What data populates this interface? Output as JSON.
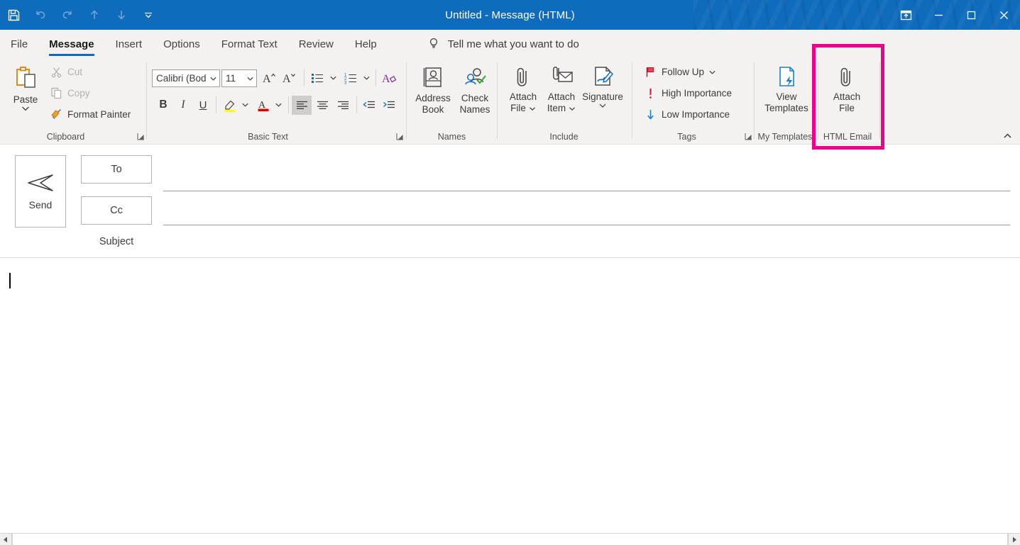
{
  "window": {
    "title": "Untitled  -  Message (HTML)",
    "accent_color": "#0f6cbd",
    "highlight_color": "#ec008c"
  },
  "quick_access": {
    "items": [
      {
        "name": "save-icon",
        "label": "Save",
        "enabled": true
      },
      {
        "name": "undo-icon",
        "label": "Undo",
        "enabled": false
      },
      {
        "name": "redo-icon",
        "label": "Redo",
        "enabled": false
      },
      {
        "name": "previous-item-icon",
        "label": "Previous Item",
        "enabled": false
      },
      {
        "name": "next-item-icon",
        "label": "Next Item",
        "enabled": false
      },
      {
        "name": "customize-quick-access-toolbar-icon",
        "label": "Customize Quick Access Toolbar",
        "enabled": true
      }
    ]
  },
  "window_controls": [
    {
      "name": "ribbon-display-options-icon",
      "label": "Ribbon Display Options"
    },
    {
      "name": "minimize-icon",
      "label": "Minimize"
    },
    {
      "name": "maximize-icon",
      "label": "Maximize"
    },
    {
      "name": "close-icon",
      "label": "Close"
    }
  ],
  "tabs": [
    {
      "label": "File",
      "active": false
    },
    {
      "label": "Message",
      "active": true
    },
    {
      "label": "Insert",
      "active": false
    },
    {
      "label": "Options",
      "active": false
    },
    {
      "label": "Format Text",
      "active": false
    },
    {
      "label": "Review",
      "active": false
    },
    {
      "label": "Help",
      "active": false
    }
  ],
  "tell_me": {
    "label": "Tell me what you want to do",
    "icon": "lightbulb-icon"
  },
  "ribbon": {
    "collapse_label": "Collapse the Ribbon",
    "groups": [
      {
        "label": "Clipboard",
        "has_dialog_launcher": true
      },
      {
        "label": "Basic Text",
        "has_dialog_launcher": true
      },
      {
        "label": "Names",
        "has_dialog_launcher": false
      },
      {
        "label": "Include",
        "has_dialog_launcher": false
      },
      {
        "label": "Tags",
        "has_dialog_launcher": true
      },
      {
        "label": "My Templates",
        "has_dialog_launcher": false
      },
      {
        "label": "HTML Email",
        "has_dialog_launcher": false
      }
    ],
    "clipboard": {
      "paste_label": "Paste",
      "cut_label": "Cut",
      "copy_label": "Copy",
      "format_painter_label": "Format Painter",
      "cut_enabled": false,
      "copy_enabled": false
    },
    "basic_text": {
      "font_name": "Calibri (Bod",
      "font_size": "11",
      "grow_font_label": "Increase Font Size",
      "shrink_font_label": "Decrease Font Size",
      "bullets_label": "Bullets",
      "numbering_label": "Numbering",
      "clear_formatting_label": "Clear All Formatting",
      "bold_label": "B",
      "italic_label": "I",
      "underline_label": "U",
      "highlight_label": "Text Highlight Color",
      "font_color_label": "Font Color",
      "align_left_label": "Align Left",
      "align_center_label": "Center",
      "align_right_label": "Align Right",
      "decrease_indent_label": "Decrease Indent",
      "increase_indent_label": "Increase Indent",
      "align_left_active": true,
      "highlight_swatch": "#ffff00",
      "font_color_swatch": "#e00000"
    },
    "names": {
      "address_book_line1": "Address",
      "address_book_line2": "Book",
      "check_names_line1": "Check",
      "check_names_line2": "Names"
    },
    "include": {
      "attach_file_line1": "Attach",
      "attach_file_line2": "File",
      "attach_item_line1": "Attach",
      "attach_item_line2": "Item",
      "signature_label": "Signature"
    },
    "tags": {
      "follow_up_label": "Follow Up",
      "high_importance_label": "High Importance",
      "low_importance_label": "Low Importance"
    },
    "my_templates": {
      "view_templates_line1": "View",
      "view_templates_line2": "Templates"
    },
    "html_email": {
      "attach_file_line1": "Attach",
      "attach_file_line2": "File",
      "highlighted": true
    }
  },
  "compose": {
    "send_label": "Send",
    "to_label": "To",
    "cc_label": "Cc",
    "subject_label": "Subject",
    "to_value": "",
    "cc_value": "",
    "subject_value": "",
    "body_value": ""
  },
  "scrollbar": {
    "left_arrow_label": "Scroll Left",
    "right_arrow_label": "Scroll Right"
  }
}
